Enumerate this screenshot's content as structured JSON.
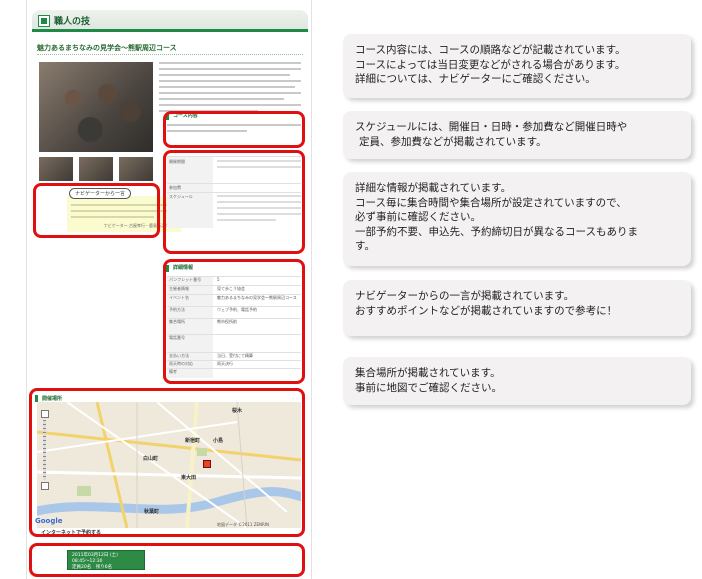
{
  "screenshot": {
    "section_title": "職人の技",
    "course_title": "魅力あるまちなみの見学会〜熊駅周辺コース",
    "section_course_content": "コース内容",
    "section_details": "詳細情報",
    "navigator_label": "ナビゲーターから一言",
    "navigator_signature": "ナビゲーター 古屋孝行・鹿島新之介さん",
    "meeting_place_heading": "開催場所",
    "reserve_heading": "インターネットで予約する",
    "google_logo": "Google",
    "map_copyright": "地図データ ©2011 ZENRIN",
    "schedule_rows": [
      {
        "label": "開催期間",
        "value": "2011年03月12日 (土) 09:45〜 最終開催 03月12日 (土) 16:00"
      },
      {
        "label": "参加費",
        "value": "3,000円"
      },
      {
        "label": "スケジュール",
        "value": ""
      }
    ],
    "detail_rows": [
      {
        "label": "パンフレット番号",
        "value": "5"
      },
      {
        "label": "主催者情報",
        "value": "見て歩こう協会"
      },
      {
        "label": "イベント名",
        "value": "魅力あるまちなみの見学会〜熊駅周辺コース"
      },
      {
        "label": "予約方法",
        "value": "ウェブ予約、電話予約"
      },
      {
        "label": "集合場所",
        "value": "熊市役所前"
      },
      {
        "label": "電話番号",
        "value": ""
      },
      {
        "label": "支払い方法",
        "value": "当日、受付にて精算"
      },
      {
        "label": "雨天時の対応",
        "value": "雨天決行"
      },
      {
        "label": "備考",
        "value": ""
      }
    ],
    "map_labels": [
      "桜木",
      "新宿町",
      "小島",
      "白山町",
      "東大田",
      "秋葉町"
    ],
    "booking": {
      "line1": "2011年03月12日 (土)",
      "line2": "08:45〜12:30",
      "line3": "定員20名　残り6名"
    }
  },
  "notes": [
    {
      "lines": [
        "コース内容には、コースの順路などが記載されています。",
        "コースによっては当日変更などがされる場合があります。",
        "詳細については、ナビゲーターにご確認ください。"
      ]
    },
    {
      "lines": [
        "スケジュールには、開催日・日時・参加費など開催日時や",
        "定員、参加費などが掲載されています。"
      ]
    },
    {
      "lines": [
        "詳細な情報が掲載されています。",
        "コース毎に集合時間や集合場所が設定されていますので、",
        "必ず事前に確認ください。",
        "一部予約不要、申込先、予約締切日が異なるコースもありま",
        "す。"
      ]
    },
    {
      "lines": [
        "ナビゲーターからの一言が掲載されています。",
        "おすすめポイントなどが掲載されていますので参考に！"
      ]
    },
    {
      "lines": [
        "集合場所が掲載されています。",
        "事前に地図でご確認ください。"
      ]
    }
  ],
  "colors": {
    "highlight": "#e01010",
    "brand_green": "#1f8a45",
    "note_background": "#f3f1f1"
  }
}
